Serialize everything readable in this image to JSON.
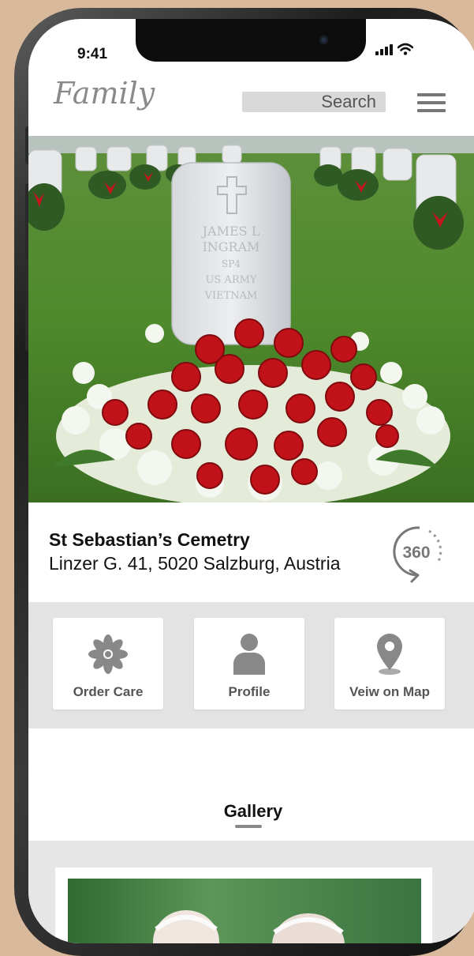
{
  "status_bar": {
    "time": "9:41"
  },
  "header": {
    "logo": "Family",
    "search_label": "Search"
  },
  "location": {
    "name": "St Sebastian’s Cemetry",
    "address": "Linzer G. 41, 5020 Salzburg, Austria",
    "view_360_label": "360"
  },
  "hero": {
    "headstone": {
      "line1": "JAMES L",
      "line2": "INGRAM",
      "line3": "SP4",
      "line4": "US ARMY",
      "line5": "VIETNAM"
    }
  },
  "actions": [
    {
      "label": "Order Care",
      "icon": "flower-icon"
    },
    {
      "label": "Profile",
      "icon": "person-icon"
    },
    {
      "label": "Veiw on Map",
      "icon": "map-pin-icon"
    }
  ],
  "gallery": {
    "title": "Gallery"
  },
  "colors": {
    "accent_gray": "#777777",
    "panel_gray": "#e3e3e3",
    "background": "#d9b99c"
  }
}
